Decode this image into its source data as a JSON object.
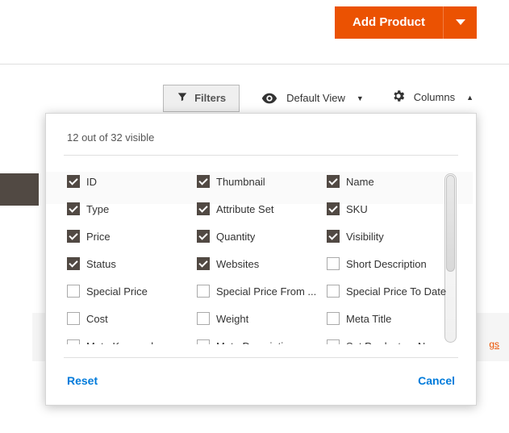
{
  "topbar": {
    "add_product_label": "Add Product"
  },
  "toolbar": {
    "filters_label": "Filters",
    "default_view_label": "Default View",
    "columns_label": "Columns"
  },
  "panel": {
    "visible_text": "12 out of 32 visible",
    "reset_label": "Reset",
    "cancel_label": "Cancel"
  },
  "columns": [
    {
      "label": "ID",
      "checked": true
    },
    {
      "label": "Thumbnail",
      "checked": true
    },
    {
      "label": "Name",
      "checked": true
    },
    {
      "label": "Type",
      "checked": true
    },
    {
      "label": "Attribute Set",
      "checked": true
    },
    {
      "label": "SKU",
      "checked": true
    },
    {
      "label": "Price",
      "checked": true
    },
    {
      "label": "Quantity",
      "checked": true
    },
    {
      "label": "Visibility",
      "checked": true
    },
    {
      "label": "Status",
      "checked": true
    },
    {
      "label": "Websites",
      "checked": true
    },
    {
      "label": "Short Description",
      "checked": false
    },
    {
      "label": "Special Price",
      "checked": false
    },
    {
      "label": "Special Price From ...",
      "checked": false
    },
    {
      "label": "Special Price To Date",
      "checked": false
    },
    {
      "label": "Cost",
      "checked": false
    },
    {
      "label": "Weight",
      "checked": false
    },
    {
      "label": "Meta Title",
      "checked": false
    },
    {
      "label": "Meta Keywords",
      "checked": false
    },
    {
      "label": "Meta Description",
      "checked": false
    },
    {
      "label": "Set Product as Ne...",
      "checked": false
    }
  ],
  "bg": {
    "link_text": "gs"
  }
}
